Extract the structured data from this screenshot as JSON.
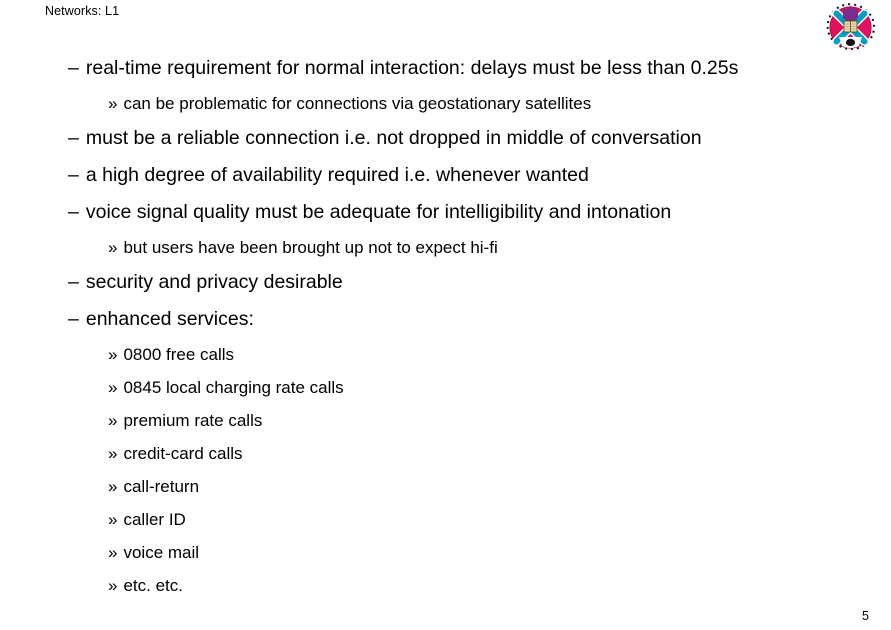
{
  "header": {
    "title": "Networks: L1"
  },
  "logo": {
    "name": "university-of-edinburgh-crest",
    "alt_text": "The University of Edinburgh crest",
    "ring_text": "THE UNIVERSITY OF EDINBURGH",
    "colors": {
      "ring_text": "#000000",
      "disc": "#e0115f",
      "saltire": "#00a0c6",
      "saltire_outline": "#ffffff",
      "chief": "#7b2d8b",
      "book": "#f0e0b8",
      "base": "#ffffff"
    }
  },
  "bullets": [
    {
      "level": 1,
      "marker": "–",
      "text": "real-time requirement for normal interaction: delays must be less than 0.25s"
    },
    {
      "level": 2,
      "marker": "»",
      "text": "can be problematic for connections via geostationary satellites"
    },
    {
      "level": 1,
      "marker": "–",
      "text": "must be a reliable connection i.e. not dropped in middle of conversation"
    },
    {
      "level": 1,
      "marker": "–",
      "text": "a high degree of availability required i.e. whenever wanted"
    },
    {
      "level": 1,
      "marker": "–",
      "text": "voice signal quality must be adequate for intelligibility and intonation"
    },
    {
      "level": 2,
      "marker": "»",
      "text": "but users have been brought up not to expect hi-fi"
    },
    {
      "level": 1,
      "marker": "–",
      "text": "security and privacy desirable"
    },
    {
      "level": 1,
      "marker": "–",
      "text": "enhanced services:"
    },
    {
      "level": 2,
      "marker": "»",
      "text": "0800 free calls"
    },
    {
      "level": 2,
      "marker": "»",
      "text": "0845 local charging rate calls"
    },
    {
      "level": 2,
      "marker": "»",
      "text": "premium rate calls"
    },
    {
      "level": 2,
      "marker": "»",
      "text": "credit-card calls"
    },
    {
      "level": 2,
      "marker": "»",
      "text": "call-return"
    },
    {
      "level": 2,
      "marker": "»",
      "text": "caller ID"
    },
    {
      "level": 2,
      "marker": "»",
      "text": "voice mail"
    },
    {
      "level": 2,
      "marker": "»",
      "text": "etc. etc."
    }
  ],
  "footer": {
    "page_number": "5"
  }
}
